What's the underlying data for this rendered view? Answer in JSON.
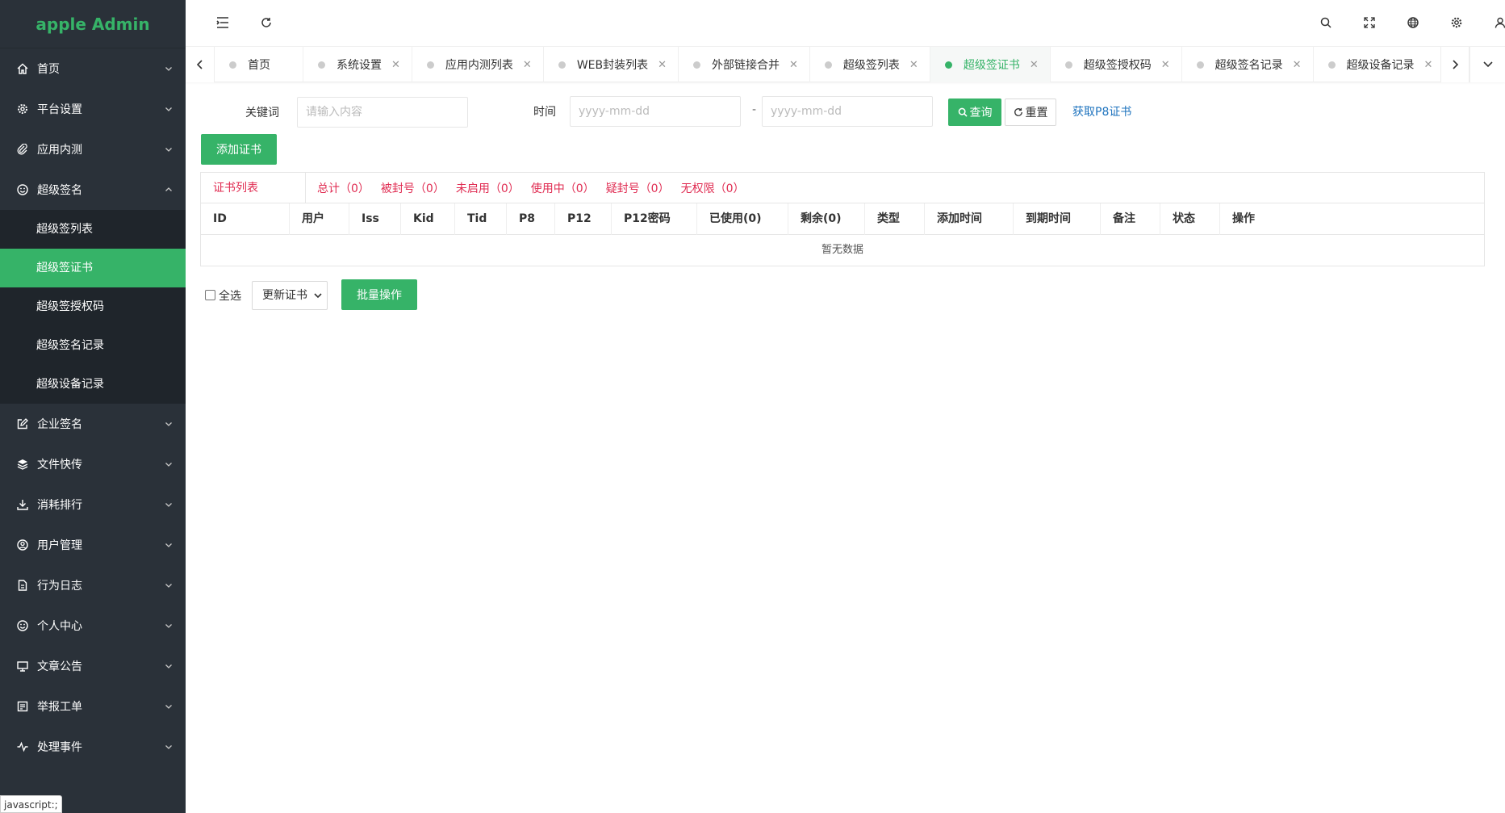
{
  "app": {
    "title": "apple Admin"
  },
  "colors": {
    "accent": "#36b368",
    "sidebar_bg": "#2a3139",
    "submenu_bg": "#1f252b",
    "stat_red": "#e02c52",
    "link_blue": "#1e73be"
  },
  "sidebar": {
    "items": [
      {
        "label": "首页",
        "icon": "home-icon"
      },
      {
        "label": "平台设置",
        "icon": "gear-icon"
      },
      {
        "label": "应用内测",
        "icon": "paperclip-icon"
      },
      {
        "label": "超级签名",
        "icon": "smile-icon",
        "expanded": true,
        "children": [
          {
            "label": "超级签列表"
          },
          {
            "label": "超级签证书",
            "active": true
          },
          {
            "label": "超级签授权码"
          },
          {
            "label": "超级签名记录"
          },
          {
            "label": "超级设备记录"
          }
        ]
      },
      {
        "label": "企业签名",
        "icon": "edit-icon"
      },
      {
        "label": "文件快传",
        "icon": "layers-icon"
      },
      {
        "label": "消耗排行",
        "icon": "download-icon"
      },
      {
        "label": "用户管理",
        "icon": "user-circle-icon"
      },
      {
        "label": "行为日志",
        "icon": "file-icon"
      },
      {
        "label": "个人中心",
        "icon": "face-icon"
      },
      {
        "label": "文章公告",
        "icon": "monitor-icon"
      },
      {
        "label": "举报工单",
        "icon": "form-icon"
      },
      {
        "label": "处理事件",
        "icon": "pulse-icon"
      }
    ],
    "status_tip": "javascript:;"
  },
  "tabs": [
    {
      "label": "首页",
      "closable": false
    },
    {
      "label": "系统设置",
      "closable": true
    },
    {
      "label": "应用内测列表",
      "closable": true
    },
    {
      "label": "WEB封装列表",
      "closable": true
    },
    {
      "label": "外部链接合并",
      "closable": true
    },
    {
      "label": "超级签列表",
      "closable": true
    },
    {
      "label": "超级签证书",
      "closable": true,
      "active": true
    },
    {
      "label": "超级签授权码",
      "closable": true
    },
    {
      "label": "超级签名记录",
      "closable": true
    },
    {
      "label": "超级设备记录",
      "closable": true
    }
  ],
  "filter": {
    "keyword_label": "关键词",
    "keyword_placeholder": "请输入内容",
    "time_label": "时间",
    "date_placeholder": "yyyy-mm-dd",
    "separator": "-",
    "query_label": "查询",
    "reset_label": "重置",
    "p8_link": "获取P8证书",
    "add_label": "添加证书"
  },
  "table": {
    "title": "证书列表",
    "stats": [
      "总计（0）",
      "被封号（0）",
      "未启用（0）",
      "使用中（0）",
      "疑封号（0）",
      "无权限（0）"
    ],
    "columns": [
      "ID",
      "用户",
      "Iss",
      "Kid",
      "Tid",
      "P8",
      "P12",
      "P12密码",
      "已使用(0)",
      "剩余(0)",
      "类型",
      "添加时间",
      "到期时间",
      "备注",
      "状态",
      "操作"
    ],
    "empty_text": "暂无数据"
  },
  "bulk": {
    "select_all_label": "全选",
    "action_selected": "更新证书",
    "batch_label": "批量操作"
  }
}
